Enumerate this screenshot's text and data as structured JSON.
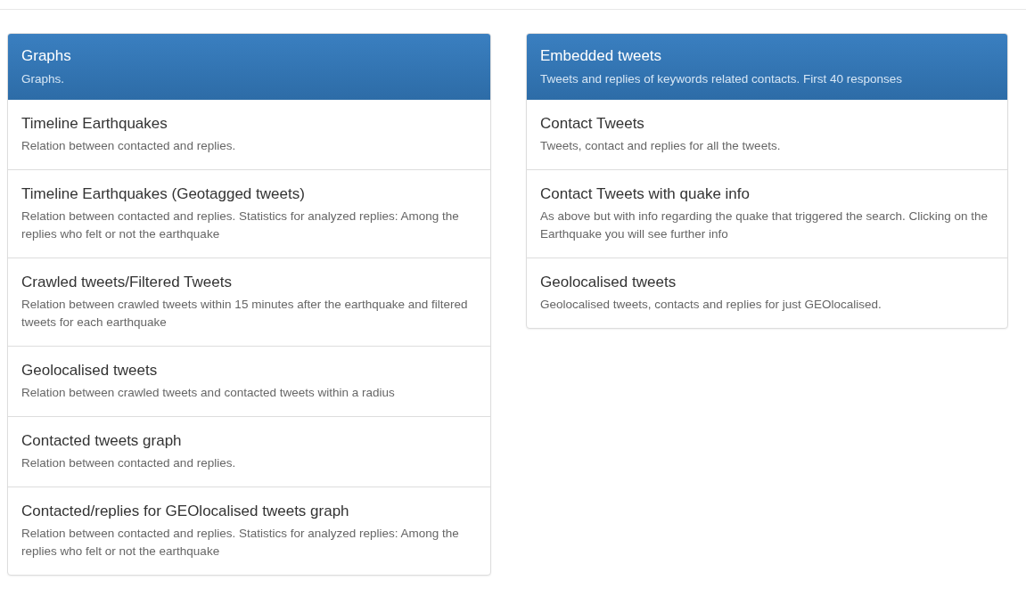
{
  "panels": [
    {
      "title": "Graphs",
      "subtitle": "Graphs.",
      "items": [
        {
          "title": "Timeline Earthquakes",
          "description": "Relation between contacted and replies."
        },
        {
          "title": "Timeline Earthquakes (Geotagged tweets)",
          "description": "Relation between contacted and replies. Statistics for analyzed replies: Among the replies who felt or not the earthquake"
        },
        {
          "title": "Crawled tweets/Filtered Tweets",
          "description": "Relation between crawled tweets within 15 minutes after the earthquake and filtered tweets for each earthquake"
        },
        {
          "title": "Geolocalised tweets",
          "description": "Relation between crawled tweets and contacted tweets within a radius"
        },
        {
          "title": "Contacted tweets graph",
          "description": "Relation between contacted and replies."
        },
        {
          "title": "Contacted/replies for GEOlocalised tweets graph",
          "description": "Relation between contacted and replies. Statistics for analyzed replies: Among the replies who felt or not the earthquake"
        }
      ]
    },
    {
      "title": "Embedded tweets",
      "subtitle": "Tweets and replies of keywords related contacts. First 40 responses",
      "items": [
        {
          "title": "Contact Tweets",
          "description": "Tweets, contact and replies for all the tweets."
        },
        {
          "title": "Contact Tweets with quake info",
          "description": "As above but with info regarding the quake that triggered the search. Clicking on the Earthquake you will see further info"
        },
        {
          "title": "Geolocalised tweets",
          "description": "Geolocalised tweets, contacts and replies for just GEOlocalised."
        }
      ]
    }
  ]
}
